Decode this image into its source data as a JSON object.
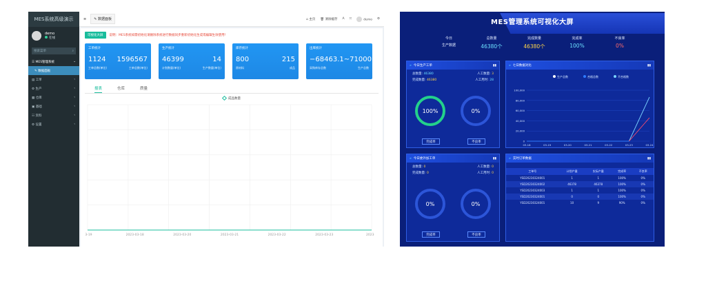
{
  "admin": {
    "app_title": "MES系统高级演示",
    "user": {
      "name": "demo",
      "status": "在线"
    },
    "search_placeholder": "搜索菜单",
    "nav": {
      "group": "MES管理系统",
      "active": "数据面板",
      "items": [
        "工单",
        "生产",
        "仓库",
        "基础",
        "资料",
        "设置"
      ]
    },
    "topbar": {
      "tab": "数据面板",
      "links": [
        "主页",
        "清除缓存"
      ],
      "user": "demo"
    },
    "notice": {
      "button": "可视化大屏",
      "text": "说明：MES系统如需初始化请删除系统进行数据同步重新初始化生成或编辑生效使用！"
    },
    "cards": [
      {
        "title": "工单统计",
        "v1": "1124",
        "v2": "1596567",
        "l1": "工单总数(单位)",
        "l2": "工单总数(单位)"
      },
      {
        "title": "生产统计",
        "v1": "46399",
        "v2": "14",
        "l1": "计划数量(单位)",
        "l2": "生产数量(单位)"
      },
      {
        "title": "库存统计",
        "v1": "800",
        "v2": "215",
        "l1": "原材料",
        "l2": "成品"
      },
      {
        "title": "出库统计",
        "v1": "−68463.1",
        "v2": "~71000",
        "l1": "采购库存总数",
        "l2": "生产总数"
      }
    ],
    "tabs": [
      "报表",
      "仓库",
      "质量"
    ],
    "chart_data": {
      "type": "line",
      "legend": "成品数量",
      "x": [
        "03-19",
        "2023-03-18",
        "2023-03-20",
        "2023-03-21",
        "2023-03-22",
        "2023-03-23",
        "2023-0"
      ],
      "series": [
        {
          "name": "成品数量",
          "values": [
            0,
            0,
            0,
            0,
            0,
            0,
            0
          ]
        }
      ],
      "grid": true
    }
  },
  "dashboard": {
    "title": "MES管理系统可视化大屏",
    "kpis": [
      {
        "label": "今日\n生产数据",
        "value": ""
      },
      {
        "label": "总数量",
        "value": "46380个"
      },
      {
        "label": "完成数量",
        "value": "46380个"
      },
      {
        "label": "完成率",
        "value": "100%"
      },
      {
        "label": "不良率",
        "value": "0%"
      }
    ],
    "today_work": {
      "title": "今日生产工单",
      "total_label": "总数量:",
      "total": "46380",
      "done_label": "完成数量:",
      "done": "46380",
      "workers_label": "人工数量:",
      "workers": "3",
      "hours_label": "人工用时:",
      "hours": "28",
      "ring1": "100%",
      "ring2": "0%",
      "btn1": "完成率",
      "btn2": "不良率"
    },
    "other_work": {
      "title": "今日委外加工单",
      "total_label": "总数量:",
      "total": "0",
      "done_label": "完成数量:",
      "done": "0",
      "workers_label": "人工数量:",
      "workers": "0",
      "hours_label": "人工用时:",
      "hours": "0",
      "ring1": "0%",
      "ring2": "0%",
      "btn1": "完成率",
      "btn2": "不良率"
    },
    "trend": {
      "title": "七日数据对比",
      "legend": [
        "生产总数",
        "合格总数",
        "不合格数"
      ],
      "y_ticks": [
        "100,000",
        "80,000",
        "60,000",
        "40,000",
        "20,000",
        "0"
      ],
      "x_ticks": [
        "03-18",
        "03-19",
        "03-20",
        "03-21",
        "03-22",
        "03-23",
        "03-24"
      ]
    },
    "orders": {
      "title": "实时订单数据",
      "headers": [
        "工单号",
        "计划产量",
        "实际产量",
        "完成率",
        "不良率"
      ],
      "rows": [
        [
          "YSD20230324001",
          "1",
          "1",
          "100%",
          "0%"
        ],
        [
          "YSD20230324002",
          "46378",
          "46378",
          "100%",
          "0%"
        ],
        [
          "YSD20230324003",
          "1",
          "1",
          "100%",
          "0%"
        ],
        [
          "YSD20230324001",
          "0",
          "0",
          "100%",
          "0%"
        ],
        [
          "YSD20230324001",
          "10",
          "9",
          "90%",
          "0%"
        ]
      ]
    }
  }
}
